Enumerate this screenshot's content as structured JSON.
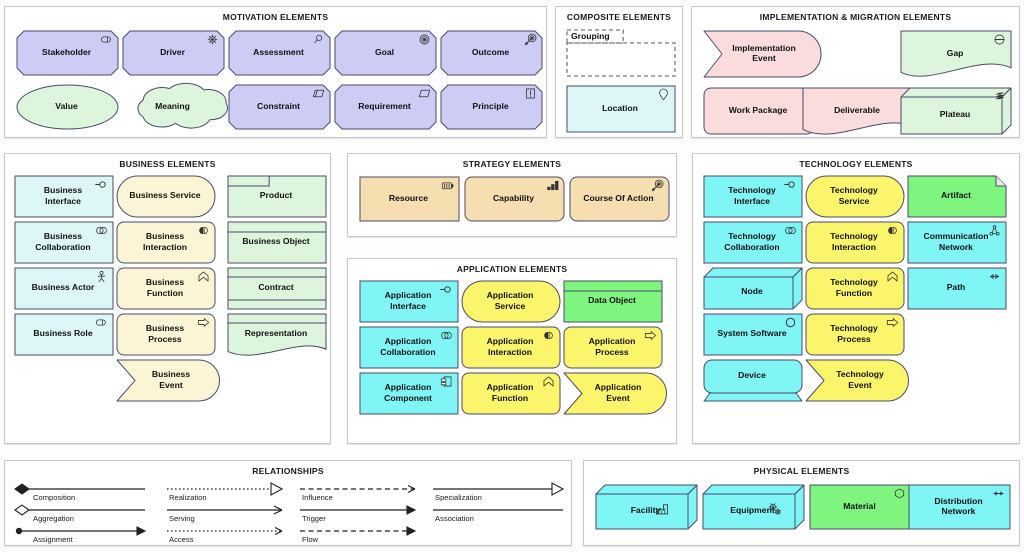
{
  "sections": {
    "motivation": {
      "title": "MOTIVATION ELEMENTS"
    },
    "composite": {
      "title": "COMPOSITE ELEMENTS"
    },
    "implementation": {
      "title": "IMPLEMENTATION & MIGRATION ELEMENTS"
    },
    "business": {
      "title": "BUSINESS ELEMENTS"
    },
    "strategy": {
      "title": "STRATEGY ELEMENTS"
    },
    "application": {
      "title": "APPLICATION ELEMENTS"
    },
    "technology": {
      "title": "TECHNOLOGY ELEMENTS"
    },
    "relationships": {
      "title": "RELATIONSHIPS"
    },
    "physical": {
      "title": "PHYSICAL ELEMENTS"
    }
  },
  "colors": {
    "motivation_purple": "#ccccf5",
    "motivation_green": "#ddf5dd",
    "composite_blue": "#ddf7f7",
    "implementation_pink": "#fadcdc",
    "implementation_green": "#ddf5dd",
    "business_blue": "#ddf7f7",
    "business_yellow": "#fbf5d5",
    "business_green": "#ddf5dd",
    "strategy_tan": "#f5deb0",
    "application_cyan": "#7ff5f5",
    "application_yellow": "#fbf56b",
    "application_green": "#7ff57f",
    "technology_cyan": "#7ff5f5",
    "technology_yellow": "#fbf56b",
    "technology_green": "#7ff57f",
    "physical_cyan": "#7ff5f5",
    "physical_green": "#7ff57f",
    "stroke": "#4a4a6a",
    "panel_border": "#c8c8c8",
    "background": "#fdfdfd"
  },
  "motivation": {
    "elements": [
      {
        "label": "Stakeholder",
        "icon": "role-icon"
      },
      {
        "label": "Driver",
        "icon": "steering-wheel-icon"
      },
      {
        "label": "Assessment",
        "icon": "magnifier-icon"
      },
      {
        "label": "Goal",
        "icon": "target-circles-icon"
      },
      {
        "label": "Outcome",
        "icon": "target-arrow-icon"
      },
      {
        "label": "Value",
        "icon": "none"
      },
      {
        "label": "Meaning",
        "icon": "none"
      },
      {
        "label": "Constraint",
        "icon": "constraint-parallelogram-icon"
      },
      {
        "label": "Requirement",
        "icon": "requirement-parallelogram-icon"
      },
      {
        "label": "Principle",
        "icon": "exclamation-box-icon"
      }
    ]
  },
  "composite": {
    "elements": [
      {
        "label": "Grouping",
        "icon": "none"
      },
      {
        "label": "Location",
        "icon": "map-pin-icon"
      }
    ]
  },
  "implementation": {
    "elements": [
      {
        "label": "Implementation\nEvent",
        "icon": "none"
      },
      {
        "label": "Gap",
        "icon": "gap-circle-icon"
      },
      {
        "label": "Work Package",
        "icon": "none"
      },
      {
        "label": "Deliverable",
        "icon": "none"
      },
      {
        "label": "Plateau",
        "icon": "plateau-layers-icon"
      }
    ]
  },
  "business": {
    "elements": [
      {
        "label": "Business\nInterface",
        "icon": "interface-lollipop-icon"
      },
      {
        "label": "Business Service",
        "icon": "none"
      },
      {
        "label": "Product",
        "icon": "none"
      },
      {
        "label": "Business\nCollaboration",
        "icon": "collaboration-circles-icon"
      },
      {
        "label": "Business\nInteraction",
        "icon": "interaction-split-icon"
      },
      {
        "label": "Business Object",
        "icon": "none"
      },
      {
        "label": "Business Actor",
        "icon": "actor-person-icon"
      },
      {
        "label": "Business\nFunction",
        "icon": "function-arrow-icon"
      },
      {
        "label": "Contract",
        "icon": "none"
      },
      {
        "label": "Business Role",
        "icon": "role-icon"
      },
      {
        "label": "Business\nProcess",
        "icon": "process-arrow-icon"
      },
      {
        "label": "Representation",
        "icon": "none"
      },
      {
        "label": "Business\nEvent",
        "icon": "none"
      }
    ]
  },
  "strategy": {
    "elements": [
      {
        "label": "Resource",
        "icon": "resource-battery-icon"
      },
      {
        "label": "Capability",
        "icon": "capability-bars-icon"
      },
      {
        "label": "Course Of Action",
        "icon": "target-arrow-icon"
      }
    ]
  },
  "application": {
    "elements": [
      {
        "label": "Application\nInterface",
        "icon": "interface-lollipop-icon"
      },
      {
        "label": "Application\nService",
        "icon": "none"
      },
      {
        "label": "Data Object",
        "icon": "none"
      },
      {
        "label": "Application\nCollaboration",
        "icon": "collaboration-circles-icon"
      },
      {
        "label": "Application\nInteraction",
        "icon": "interaction-split-icon"
      },
      {
        "label": "Application\nProcess",
        "icon": "process-arrow-icon"
      },
      {
        "label": "Application\nComponent",
        "icon": "component-icon"
      },
      {
        "label": "Application\nFunction",
        "icon": "function-arrow-icon"
      },
      {
        "label": "Application\nEvent",
        "icon": "none"
      }
    ]
  },
  "technology": {
    "elements": [
      {
        "label": "Technology\nInterface",
        "icon": "interface-lollipop-icon"
      },
      {
        "label": "Technology\nService",
        "icon": "none"
      },
      {
        "label": "Artifact",
        "icon": "none"
      },
      {
        "label": "Technology\nCollaboration",
        "icon": "collaboration-circles-icon"
      },
      {
        "label": "Technology\nInteraction",
        "icon": "interaction-split-icon"
      },
      {
        "label": "Communication\nNetwork",
        "icon": "network-nodes-icon"
      },
      {
        "label": "Node",
        "icon": "none"
      },
      {
        "label": "Technology\nFunction",
        "icon": "function-arrow-icon"
      },
      {
        "label": "Path",
        "icon": "path-arrows-icon"
      },
      {
        "label": "System Software",
        "icon": "system-software-circle-icon"
      },
      {
        "label": "Technology\nProcess",
        "icon": "process-arrow-icon"
      },
      {
        "label": "Device",
        "icon": "none"
      },
      {
        "label": "Technology\nEvent",
        "icon": "none"
      }
    ]
  },
  "physical": {
    "elements": [
      {
        "label": "Facility",
        "icon": "factory-icon"
      },
      {
        "label": "Equipment",
        "icon": "gears-icon"
      },
      {
        "label": "Material",
        "icon": "material-hex-icon"
      },
      {
        "label": "Distribution\nNetwork",
        "icon": "double-arrow-icon"
      }
    ]
  },
  "relationships": {
    "items": [
      {
        "label": "Composition",
        "style": "solid-line-filled-diamond-start"
      },
      {
        "label": "Aggregation",
        "style": "solid-line-hollow-diamond-start"
      },
      {
        "label": "Assignment",
        "style": "solid-line-ball-start-filled-arrow-end"
      },
      {
        "label": "Realization",
        "style": "dotted-line-hollow-triangle-end"
      },
      {
        "label": "Serving",
        "style": "solid-line-open-arrow-end"
      },
      {
        "label": "Access",
        "style": "dotted-line-small-open-arrow-end"
      },
      {
        "label": "Influence",
        "style": "dashed-line-small-open-arrow-end"
      },
      {
        "label": "Trigger",
        "style": "solid-line-filled-arrow-end"
      },
      {
        "label": "Flow",
        "style": "dashed-line-filled-arrow-end"
      },
      {
        "label": "Specialization",
        "style": "solid-line-hollow-triangle-end"
      },
      {
        "label": "Association",
        "style": "solid-line-plain"
      }
    ]
  }
}
